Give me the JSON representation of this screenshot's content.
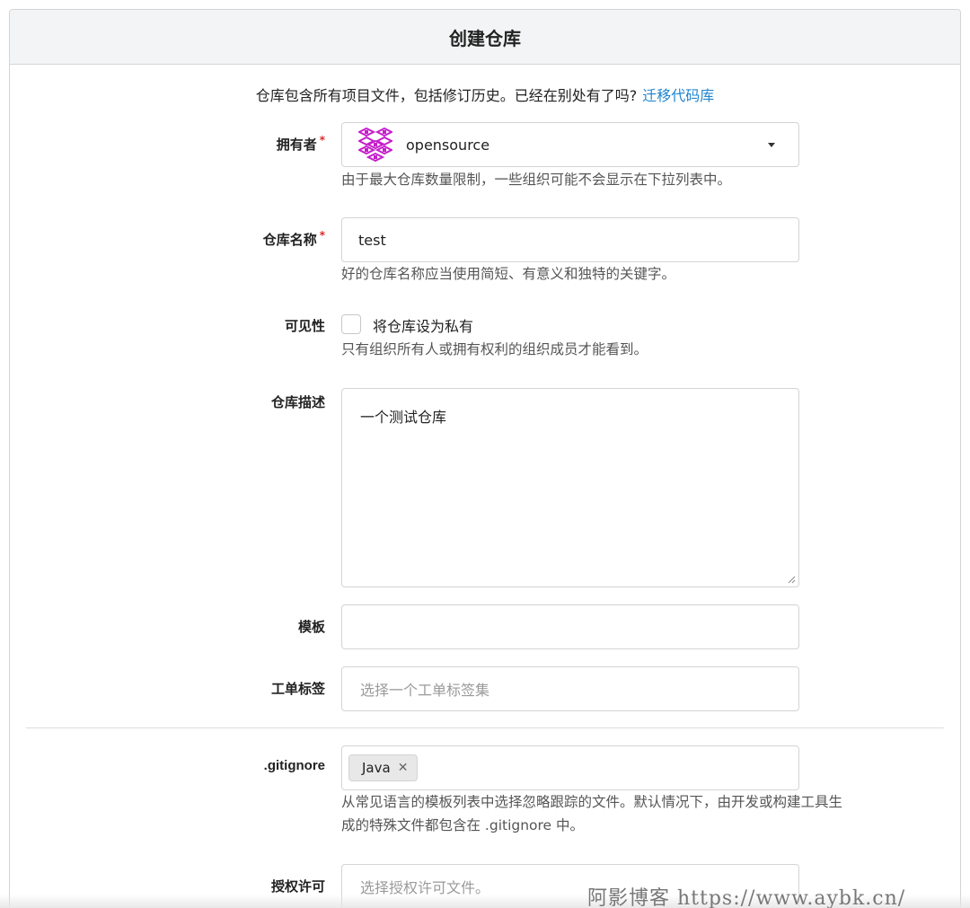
{
  "header": {
    "title": "创建仓库"
  },
  "intro": {
    "text": "仓库包含所有项目文件，包括修订历史。已经在别处有了吗?",
    "link": "迁移代码库"
  },
  "owner": {
    "label": "拥有者",
    "required_mark": "*",
    "value": "opensource",
    "help": "由于最大仓库数量限制，一些组织可能不会显示在下拉列表中。"
  },
  "repo_name": {
    "label": "仓库名称",
    "required_mark": "*",
    "value": "test",
    "help": "好的仓库名称应当使用简短、有意义和独特的关键字。"
  },
  "visibility": {
    "label": "可见性",
    "checkbox_label": "将仓库设为私有",
    "help": "只有组织所有人或拥有权利的组织成员才能看到。"
  },
  "description": {
    "label": "仓库描述",
    "value": "一个测试仓库"
  },
  "template": {
    "label": "模板",
    "value": ""
  },
  "issue_labels": {
    "label": "工单标签",
    "placeholder": "选择一个工单标签集"
  },
  "gitignore": {
    "label": ".gitignore",
    "tags": [
      "Java"
    ],
    "help_line1": "从常见语言的模板列表中选择忽略跟踪的文件。默认情况下，由开发或构建工具生",
    "help_line2": "成的特殊文件都包含在 .gitignore 中。"
  },
  "license": {
    "label": "授权许可",
    "placeholder": "选择授权许可文件。"
  },
  "watermark": "阿影博客 https://www.aybk.cn/",
  "colors": {
    "link": "#2185d0",
    "required": "#db2828",
    "avatar": "#c51ecb"
  }
}
